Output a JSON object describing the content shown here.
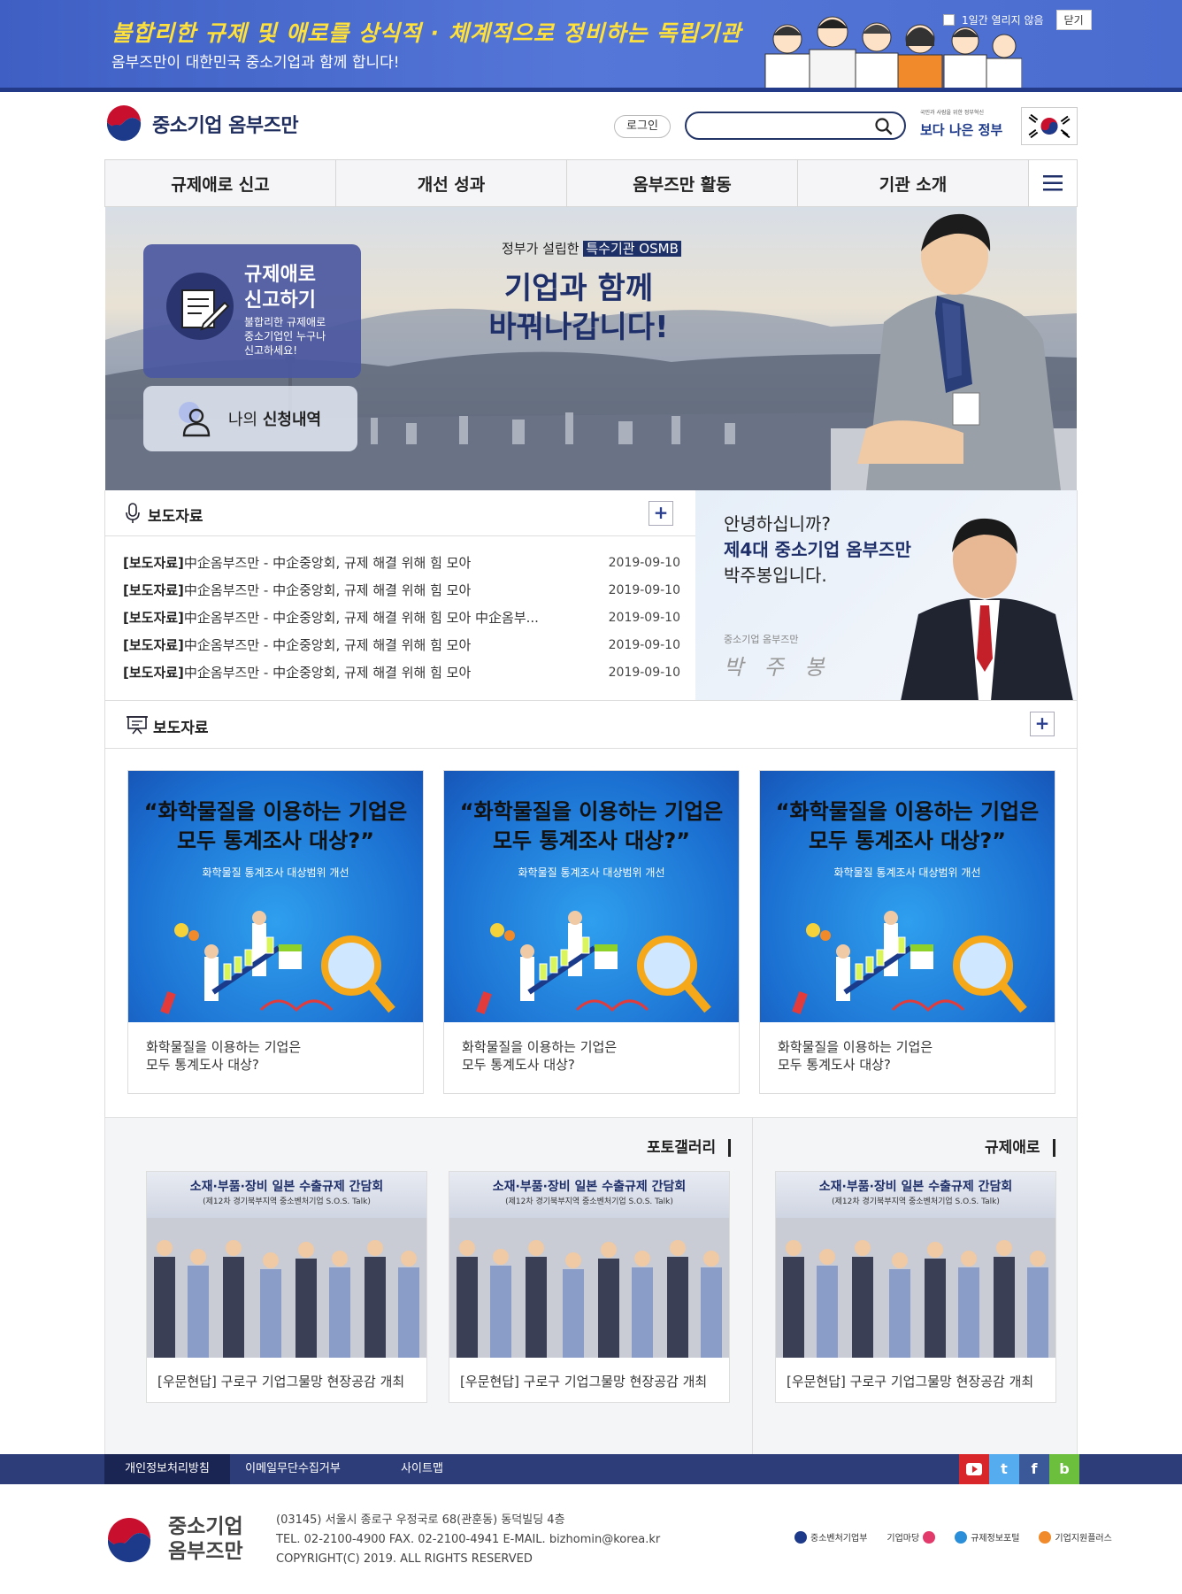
{
  "top_banner": {
    "headline": "불합리한  규제 및 애로를 상식적 · 체계적으로  정비하는 독립기관",
    "subline": "옴부즈만이  대한민국  중소기업과 함께 합니다!",
    "hide_label": "1일간 열리지 않음",
    "close_label": "닫기"
  },
  "header": {
    "logo_text": "중소기업 옴부즈만",
    "login_label": "로그인",
    "search_placeholder": "",
    "gov_slogan_small": "국민과 사람을 위한 정부혁신",
    "gov_slogan": "보다 나은 정부"
  },
  "gnb": {
    "items": [
      "규제애로 신고",
      "개선 성과",
      "옴부즈만 활동",
      "기관 소개"
    ]
  },
  "hero": {
    "report_title_1": "규제애로",
    "report_title_2": "신고하기",
    "report_desc_1": "불합리한 규제애로",
    "report_desc_2": "중소기업인 누구나",
    "report_desc_3": "신고하세요!",
    "history_prefix": "나의 ",
    "history_bold": "신청내역",
    "caption_prefix": "정부가 설립한 ",
    "caption_highlight": "특수기관 OSMB",
    "title_1": "기업과 함께",
    "title_2": "바꿔나갑니다!"
  },
  "news": {
    "title": "보도자료",
    "items": [
      {
        "tag": "[보도자료]",
        "text": "中企옴부즈만 - 中企중앙회, 규제 해결 위해 힘 모아",
        "date": "2019-09-10"
      },
      {
        "tag": "[보도자료]",
        "text": "中企옴부즈만 - 中企중앙회, 규제 해결 위해 힘 모아",
        "date": "2019-09-10"
      },
      {
        "tag": "[보도자료]",
        "text": "中企옴부즈만 - 中企중앙회, 규제 해결 위해 힘 모아 中企옴부...",
        "date": "2019-09-10"
      },
      {
        "tag": "[보도자료]",
        "text": "中企옴부즈만 - 中企중앙회, 규제 해결 위해 힘 모아",
        "date": "2019-09-10"
      },
      {
        "tag": "[보도자료]",
        "text": "中企옴부즈만 - 中企중앙회, 규제 해결 위해 힘 모아",
        "date": "2019-09-10"
      }
    ]
  },
  "greeting": {
    "line1": "안녕하십니까?",
    "line2": "제4대 중소기업 옴부즈만",
    "line3": "박주봉입니다.",
    "small": "중소기업 옴부즈만",
    "signature": "박 주 봉"
  },
  "cards": {
    "title": "보도자료",
    "items": [
      {
        "img_title_1": "“화학물질을 이용하는 기업은",
        "img_title_2": "모두 통계조사 대상?”",
        "img_sub": "화학물질 통계조사 대상범위 개선",
        "cap_1": "화학물질을 이용하는 기업은",
        "cap_2": "모두 통계도사 대상?"
      },
      {
        "img_title_1": "“화학물질을 이용하는 기업은",
        "img_title_2": "모두 통계조사 대상?”",
        "img_sub": "화학물질 통계조사 대상범위 개선",
        "cap_1": "화학물질을 이용하는 기업은",
        "cap_2": "모두 통계도사 대상?"
      },
      {
        "img_title_1": "“화학물질을 이용하는 기업은",
        "img_title_2": "모두 통계조사 대상?”",
        "img_sub": "화학물질 통계조사 대상범위 개선",
        "cap_1": "화학물질을 이용하는 기업은",
        "cap_2": "모두 통계도사 대상?"
      }
    ]
  },
  "gallery": {
    "title_photo": "포토갤러리",
    "title_regulation": "규제애로",
    "items": [
      {
        "banner_1": "소재·부품·장비 일본 수출규제 간담회",
        "banner_2": "(제12차 경기북부지역 중소벤처기업 S.O.S. Talk)",
        "caption": "[우문현답] 구로구 기업그물망 현장공감 개최"
      },
      {
        "banner_1": "소재·부품·장비 일본 수출규제 간담회",
        "banner_2": "(제12차 경기북부지역 중소벤처기업 S.O.S. Talk)",
        "caption": "[우문현답] 구로구 기업그물망 현장공감 개최"
      },
      {
        "banner_1": "소재·부품·장비 일본 수출규제 간담회",
        "banner_2": "(제12차 경기북부지역 중소벤처기업 S.O.S. Talk)",
        "caption": "[우문현답] 구로구 기업그물망 현장공감 개최"
      }
    ]
  },
  "footer_nav": {
    "privacy": "개인정보처리방침",
    "email_refuse": "이메일무단수집거부",
    "sitemap": "사이트맵",
    "social": [
      "youtube",
      "twitter",
      "facebook",
      "blog"
    ]
  },
  "footer": {
    "logo_1": "중소기업",
    "logo_2": "옴부즈만",
    "address": "(03145) 서울시 종로구 우정국로 68(관훈동) 동덕빌딩 4층",
    "contact": "TEL. 02-2100-4900   FAX. 02-2100-4941   E-MAIL. bizhomin@korea.kr",
    "copyright": "COPYRIGHT(C) 2019. ALL RIGHTS RESERVED",
    "partners": [
      "중소벤처기업부",
      "기업마당",
      "규제정보포털",
      "기업지원플러스"
    ]
  },
  "colors": {
    "banner_blue": "#4a6ccf",
    "navy": "#1e2f6a",
    "footer_nav": "#2d3d7a",
    "youtube": "#d9262b",
    "twitter": "#55acee",
    "facebook": "#3b5998",
    "blog": "#6bbf3c"
  }
}
